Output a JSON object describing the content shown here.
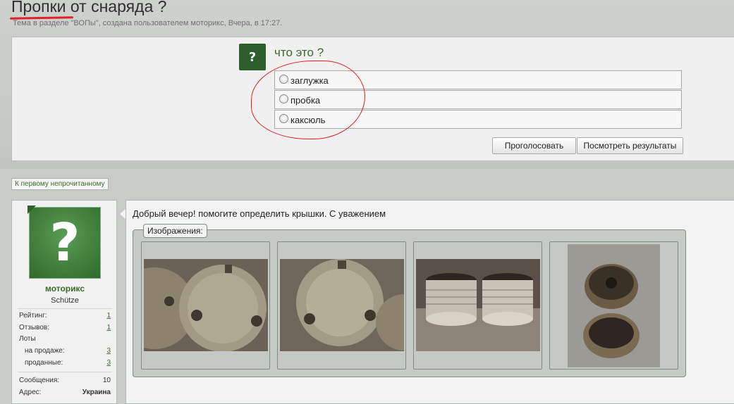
{
  "thread": {
    "title": "Пропки от снаряда ?",
    "meta": "Тема в разделе \"ВОПы\", создана пользователем моторикс, Вчера, в 17:27."
  },
  "poll": {
    "icon": "?",
    "question": "что это ?",
    "options": [
      {
        "label": "заглужка"
      },
      {
        "label": "пробка"
      },
      {
        "label": "каксюль"
      }
    ],
    "vote_button": "Проголосовать",
    "results_button": "Посмотреть результаты"
  },
  "nav": {
    "first_unread": "К первому непрочитанному"
  },
  "user": {
    "name": "моторикс",
    "rank": "Schütze",
    "stats": [
      {
        "label": "Рейтинг:",
        "value": "1"
      },
      {
        "label": "Отзывов:",
        "value": "1"
      },
      {
        "label": "Лоты",
        "value": ""
      },
      {
        "label": "на продаже:",
        "value": "3"
      },
      {
        "label": "проданные:",
        "value": "3"
      },
      {
        "label": "Сообщения:",
        "value": "10"
      },
      {
        "label": "Адрес:",
        "value": "Украина"
      }
    ]
  },
  "post": {
    "text": "Добрый вечер! помогите определить крышки. С уважением",
    "attachments_label": "Изображения:",
    "images": [
      {
        "icon": "brass-caps-photo-1"
      },
      {
        "icon": "brass-caps-photo-2"
      },
      {
        "icon": "threaded-plugs-photo"
      },
      {
        "icon": "corroded-caps-photo"
      }
    ]
  },
  "colors": {
    "accent_green": "#3b6b2c",
    "poll_icon_bg": "#2d5f2c",
    "red_annotation": "#e0202a"
  }
}
